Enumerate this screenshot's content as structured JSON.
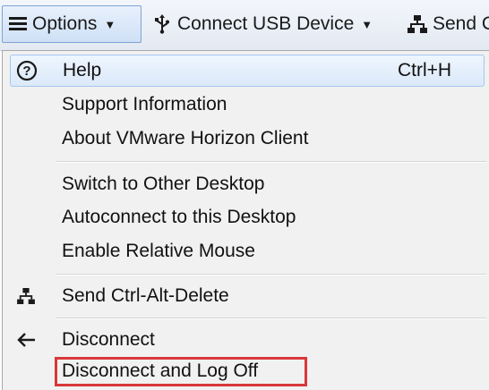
{
  "toolbar": {
    "options_label": "Options",
    "usb_label": "Connect USB Device",
    "send_label": "Send C"
  },
  "menu": {
    "help": {
      "label": "Help",
      "shortcut": "Ctrl+H",
      "icon": "help-circle-icon"
    },
    "support_info": {
      "label": "Support Information"
    },
    "about": {
      "label": "About VMware Horizon Client"
    },
    "switch_desktop": {
      "label": "Switch to Other Desktop"
    },
    "autoconnect": {
      "label": "Autoconnect to this Desktop"
    },
    "relative_mouse": {
      "label": "Enable Relative Mouse"
    },
    "send_cad": {
      "label": "Send Ctrl-Alt-Delete",
      "icon": "network-icon"
    },
    "disconnect": {
      "label": "Disconnect",
      "icon": "arrow-left-icon"
    },
    "disconnect_logoff": {
      "label": "Disconnect and Log Off"
    }
  },
  "colors": {
    "highlight_border": "#a6c6ee",
    "annotation_red": "#d9383a",
    "menu_background": "#f1f1f1"
  }
}
